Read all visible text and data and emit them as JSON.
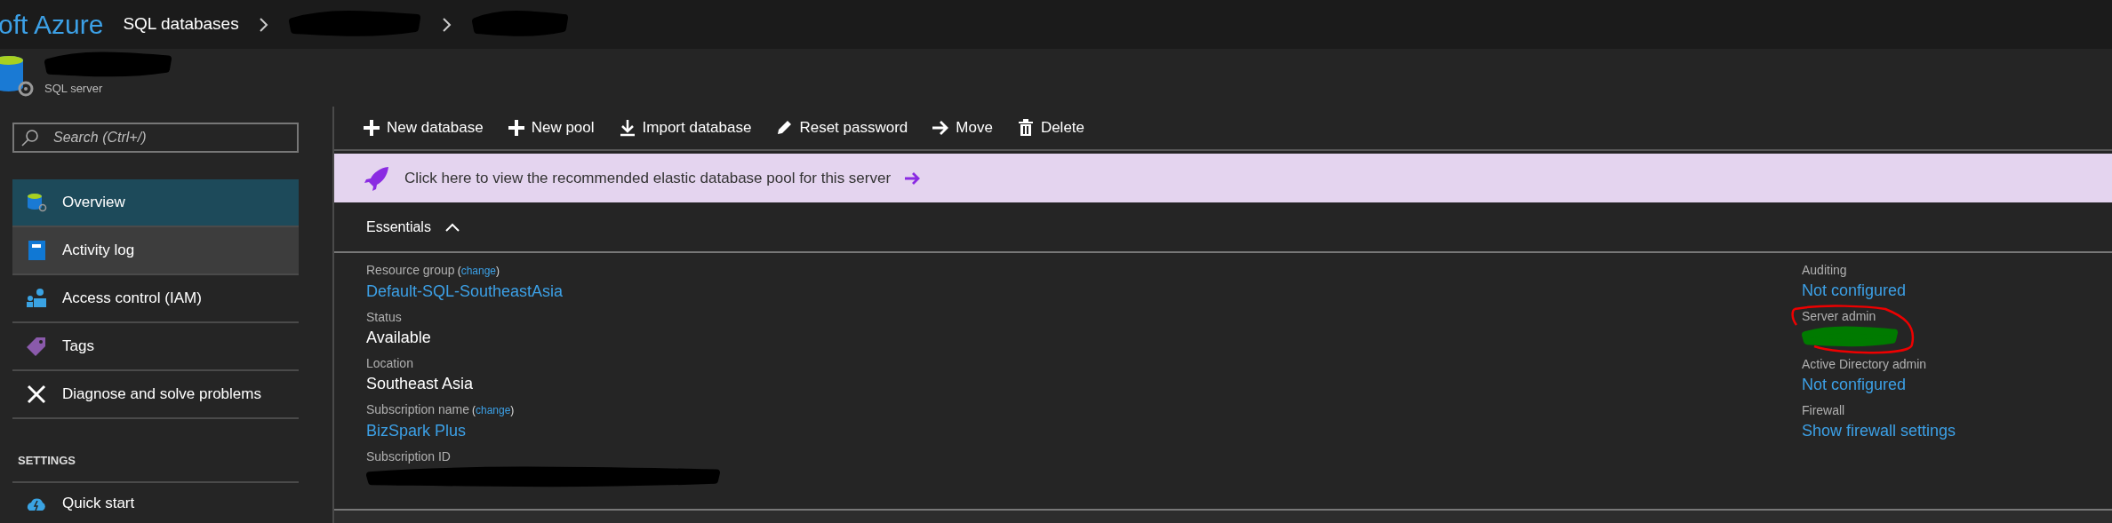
{
  "brand": "oft Azure",
  "breadcrumb": [
    {
      "label": "SQL databases",
      "redacted": false
    },
    {
      "redacted": true
    },
    {
      "redacted": true
    }
  ],
  "header": {
    "title_redacted": true,
    "subtitle": "SQL server"
  },
  "search": {
    "placeholder": "Search (Ctrl+/)"
  },
  "sidebar": {
    "items": [
      {
        "label": "Overview",
        "selected": true,
        "hovered": false
      },
      {
        "label": "Activity log",
        "selected": false,
        "hovered": true
      },
      {
        "label": "Access control (IAM)",
        "selected": false,
        "hovered": false
      },
      {
        "label": "Tags",
        "selected": false,
        "hovered": false
      },
      {
        "label": "Diagnose and solve problems",
        "selected": false,
        "hovered": false
      }
    ],
    "section": "SETTINGS",
    "section_items": [
      {
        "label": "Quick start",
        "selected": false,
        "hovered": false
      }
    ]
  },
  "toolbar": [
    "New database",
    "New pool",
    "Import database",
    "Reset password",
    "Move",
    "Delete"
  ],
  "banner": {
    "text": "Click here to view the recommended elastic database pool for this server"
  },
  "essentials": {
    "title": "Essentials",
    "expanded": true,
    "left": [
      {
        "label": "Resource group",
        "change": {
          "open": "(",
          "link": "change",
          "close": ")"
        },
        "kind": "link",
        "value": "Default-SQL-SoutheastAsia",
        "circled": false
      },
      {
        "label": "Status",
        "kind": "text",
        "value": "Available",
        "circled": false
      },
      {
        "label": "Location",
        "kind": "text",
        "value": "Southeast Asia",
        "circled": false
      },
      {
        "label": "Subscription name",
        "change": {
          "open": "(",
          "link": "change",
          "close": ")"
        },
        "kind": "link",
        "value": "BizSpark Plus",
        "circled": false
      },
      {
        "label": "Subscription ID",
        "kind": "redacted",
        "circled": false
      }
    ],
    "right": [
      {
        "label": "Auditing",
        "kind": "link",
        "value": "Not configured",
        "circled": false
      },
      {
        "label": "Server admin",
        "kind": "redacted",
        "circled": true
      },
      {
        "label": "Active Directory admin",
        "kind": "link",
        "value": "Not configured",
        "circled": false
      },
      {
        "label": "Firewall",
        "kind": "link",
        "value": "Show firewall settings",
        "circled": false
      }
    ]
  }
}
